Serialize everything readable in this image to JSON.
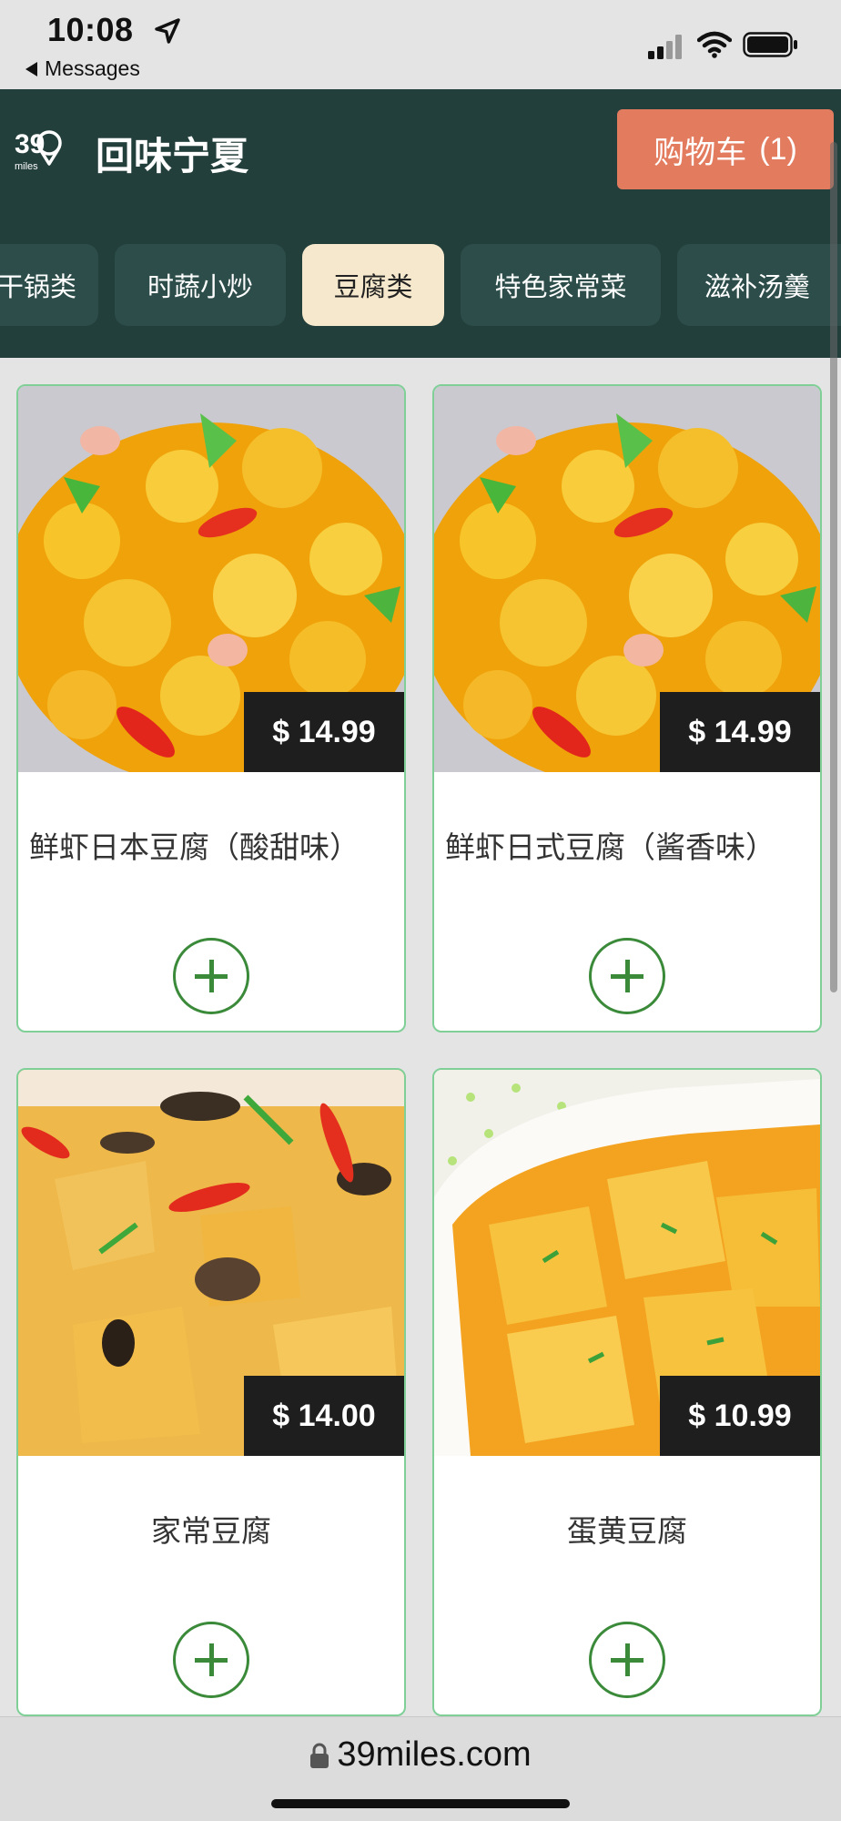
{
  "status_bar": {
    "time": "10:08",
    "back_label": "Messages"
  },
  "header": {
    "logo_text": "39",
    "logo_subtext": "miles",
    "store_title": "回味宁夏",
    "cart_label": "购物车",
    "cart_count": "(1)"
  },
  "tabs": [
    {
      "label": "干锅类",
      "active": false
    },
    {
      "label": "时蔬小炒",
      "active": false
    },
    {
      "label": "豆腐类",
      "active": true
    },
    {
      "label": "特色家常菜",
      "active": false
    },
    {
      "label": "滋补汤羹",
      "active": false
    }
  ],
  "products": [
    {
      "name": "鲜虾日本豆腐（酸甜味）",
      "price": "$ 14.99"
    },
    {
      "name": "鲜虾日式豆腐（酱香味）",
      "price": "$ 14.99"
    },
    {
      "name": "家常豆腐",
      "price": "$ 14.00"
    },
    {
      "name": "蛋黄豆腐",
      "price": "$ 10.99"
    }
  ],
  "browser": {
    "url": "39miles.com"
  },
  "colors": {
    "header_bg": "#233f3c",
    "tab_bg": "#2d4d4a",
    "tab_active_bg": "#f5e8cc",
    "cart_button": "#e37b5f",
    "card_border": "#7fcf97",
    "add_button": "#3a8a3a"
  }
}
